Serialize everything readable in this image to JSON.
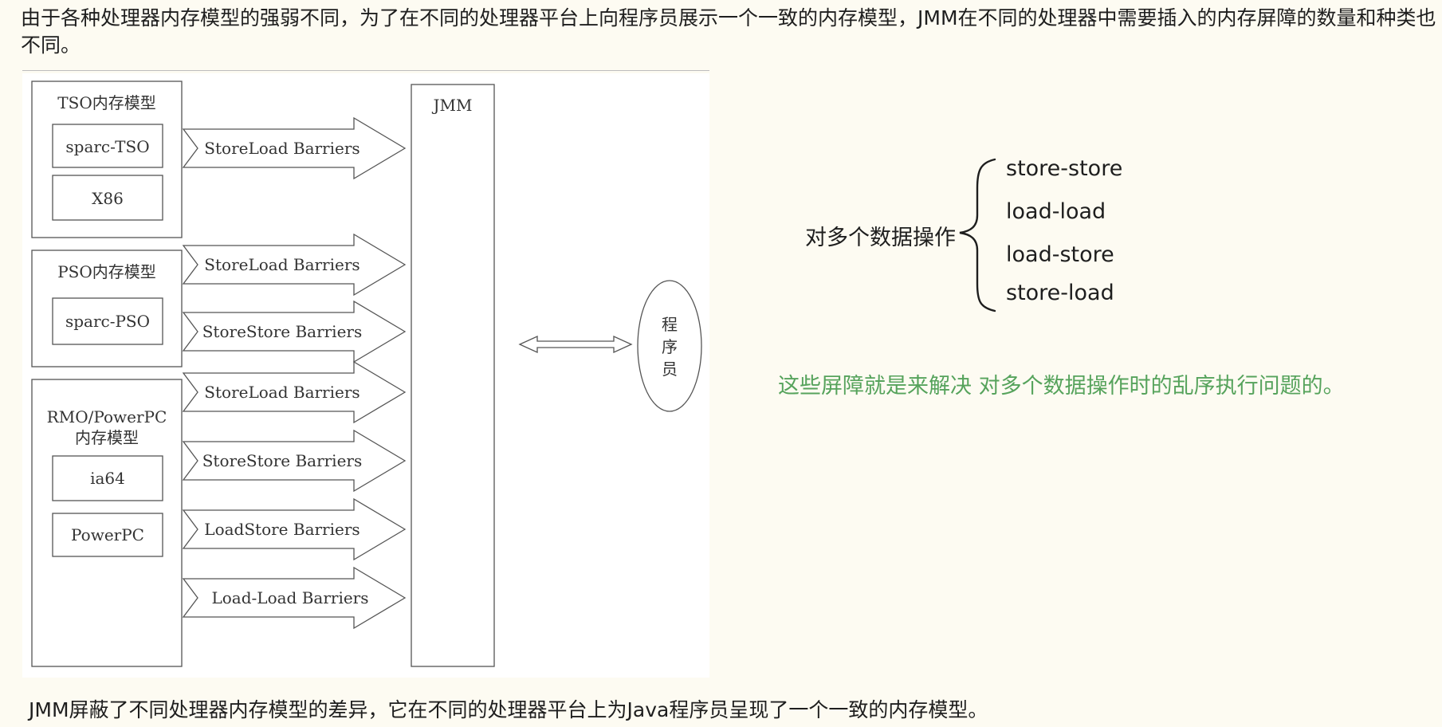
{
  "intro_text": "由于各种处理器内存模型的强弱不同，为了在不同的处理器平台上向程序员展示一个一致的内存模型，JMM在不同的处理器中需要插入的内存屏障的数量和种类也不同。",
  "diagram": {
    "groups": [
      {
        "title": "TSO内存模型",
        "items": [
          "sparc-TSO",
          "X86"
        ]
      },
      {
        "title": "PSO内存模型",
        "items": [
          "sparc-PSO"
        ]
      },
      {
        "title_line1": "RMO/PowerPC",
        "title_line2": "内存模型",
        "items": [
          "ia64",
          "PowerPC"
        ]
      }
    ],
    "arrows": [
      "StoreLoad Barriers",
      "StoreLoad Barriers",
      "StoreStore Barriers",
      "StoreLoad Barriers",
      "StoreStore Barriers",
      "LoadStore Barriers",
      "Load-Load Barriers"
    ],
    "jmm_label": "JMM",
    "programmer_chars": [
      "程",
      "序",
      "员"
    ]
  },
  "annotation": {
    "title": "对多个数据操作",
    "ops": [
      "store-store",
      "load-load",
      "load-store",
      "store-load"
    ],
    "note": "这些屏障就是来解决 对多个数据操作时的乱序执行问题的。",
    "note_color": "#56a35c"
  },
  "bottom_text": "JMM屏蔽了不同处理器内存模型的差异，它在不同的处理器平台上为Java程序员呈现了一个一致的内存模型。"
}
